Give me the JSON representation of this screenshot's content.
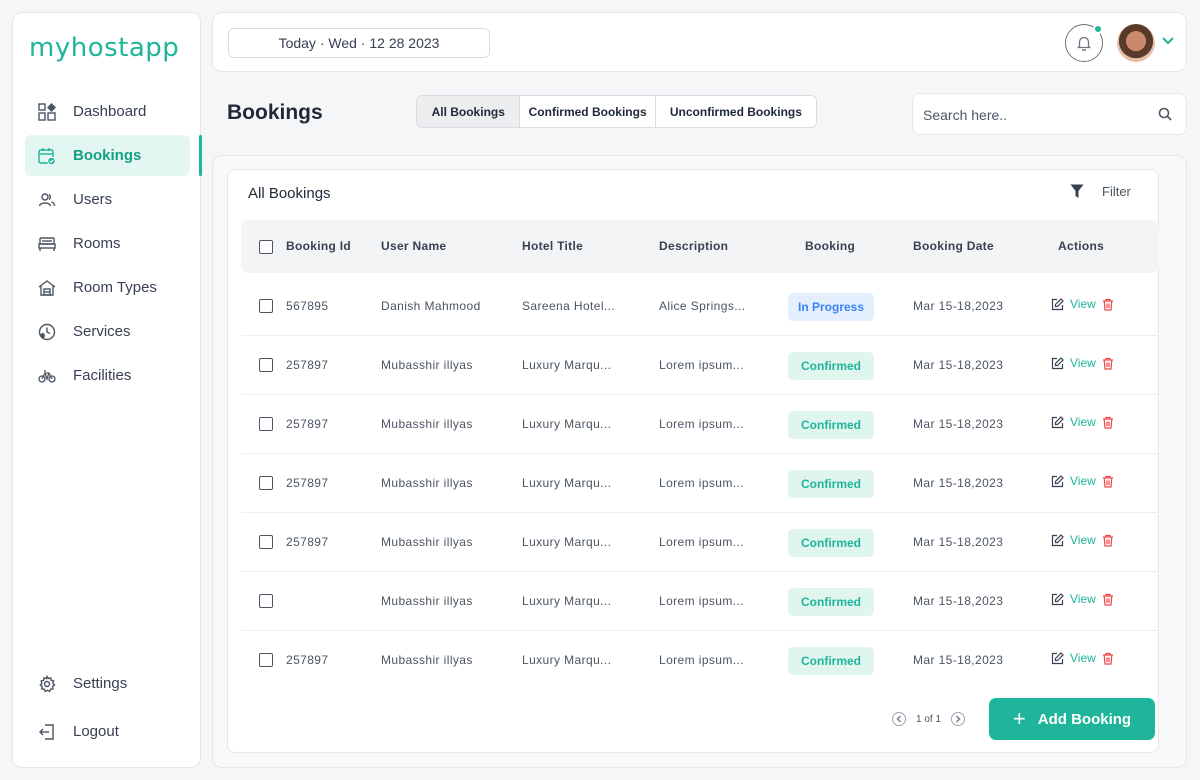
{
  "app": {
    "logo_text": "myhostapp",
    "accent": "#1fb59a"
  },
  "sidebar": {
    "items": [
      {
        "label": "Dashboard",
        "icon": "dashboard-icon"
      },
      {
        "label": "Bookings",
        "icon": "calendar-check-icon",
        "active": true
      },
      {
        "label": "Users",
        "icon": "users-icon"
      },
      {
        "label": "Rooms",
        "icon": "bed-icon"
      },
      {
        "label": "Room Types",
        "icon": "house-icon"
      },
      {
        "label": "Services",
        "icon": "phone-clock-icon"
      },
      {
        "label": "Facilities",
        "icon": "bicycle-icon"
      }
    ],
    "bottom": [
      {
        "label": "Settings",
        "icon": "gear-icon"
      },
      {
        "label": "Logout",
        "icon": "logout-icon"
      }
    ]
  },
  "topbar": {
    "date_text": "Today · Wed · 12 28 2023"
  },
  "header": {
    "title": "Bookings",
    "tabs": [
      "All Bookings",
      "Confirmed Bookings",
      "Unconfirmed Bookings"
    ],
    "search_placeholder": "Search here.."
  },
  "table": {
    "title": "All Bookings",
    "filter_label": "Filter",
    "columns": [
      "Booking Id",
      "User Name",
      "Hotel Title",
      "Description",
      "Booking",
      "Booking Date",
      "Actions"
    ],
    "view_label": "View",
    "rows": [
      {
        "id": "567895",
        "user": "Danish Mahmood",
        "hotel": "Sareena Hotel...",
        "desc": "Alice Springs...",
        "status": "In Progress",
        "date": "Mar 15-18,2023"
      },
      {
        "id": "257897",
        "user": "Mubasshir illyas",
        "hotel": "Luxury Marqu...",
        "desc": "Lorem ipsum...",
        "status": "Confirmed",
        "date": "Mar 15-18,2023"
      },
      {
        "id": "257897",
        "user": "Mubasshir illyas",
        "hotel": "Luxury Marqu...",
        "desc": "Lorem ipsum...",
        "status": "Confirmed",
        "date": "Mar 15-18,2023"
      },
      {
        "id": "257897",
        "user": "Mubasshir illyas",
        "hotel": "Luxury Marqu...",
        "desc": "Lorem ipsum...",
        "status": "Confirmed",
        "date": "Mar 15-18,2023"
      },
      {
        "id": "257897",
        "user": "Mubasshir illyas",
        "hotel": "Luxury Marqu...",
        "desc": "Lorem ipsum...",
        "status": "Confirmed",
        "date": "Mar 15-18,2023"
      },
      {
        "id": "",
        "user": "Mubasshir illyas",
        "hotel": "Luxury Marqu...",
        "desc": "Lorem ipsum...",
        "status": "Confirmed",
        "date": "Mar 15-18,2023"
      },
      {
        "id": "257897",
        "user": "Mubasshir illyas",
        "hotel": "Luxury Marqu...",
        "desc": "Lorem ipsum...",
        "status": "Confirmed",
        "date": "Mar 15-18,2023"
      }
    ]
  },
  "pagination": {
    "text": "1 of 1"
  },
  "add_button_label": "Add Booking"
}
